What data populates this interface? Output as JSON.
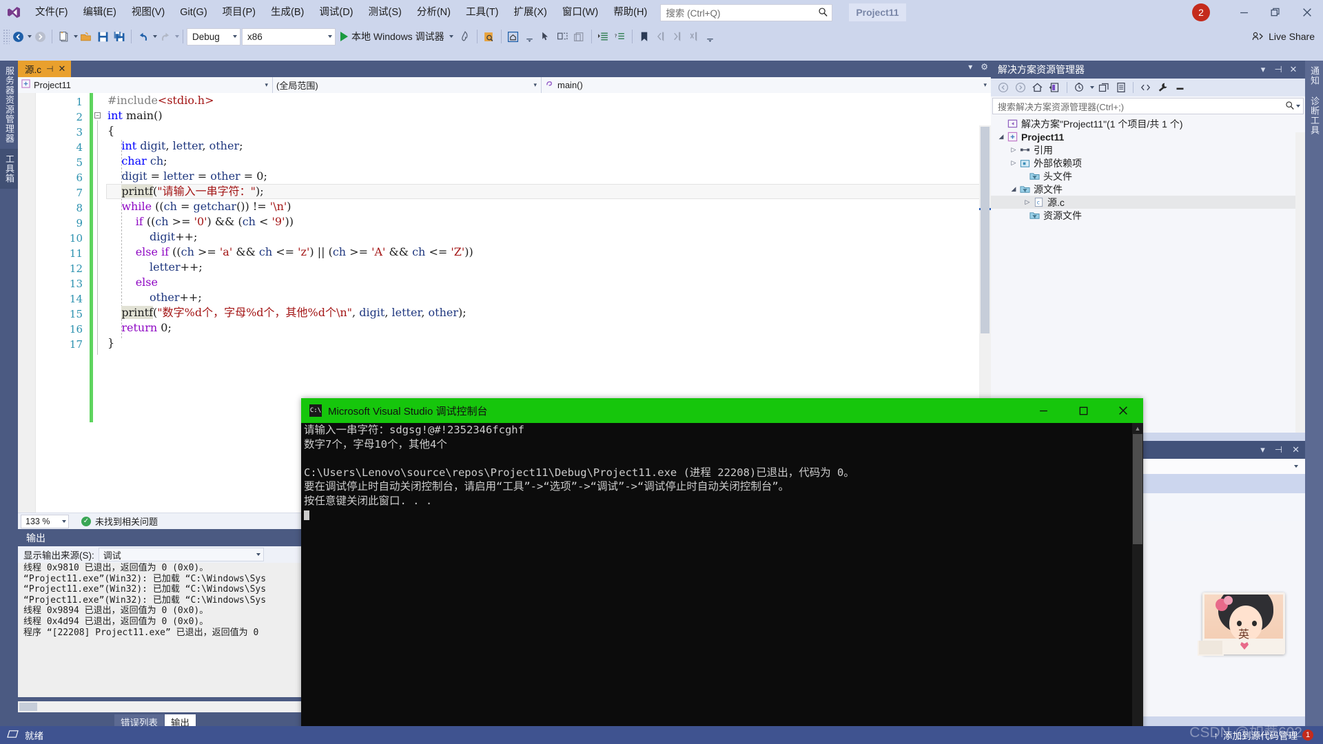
{
  "app": {
    "logo_icon": "visual-studio-icon",
    "project_chip": "Project11",
    "notification_count": "2"
  },
  "menu": {
    "items": [
      {
        "label": "文件(F)"
      },
      {
        "label": "编辑(E)"
      },
      {
        "label": "视图(V)"
      },
      {
        "label": "Git(G)"
      },
      {
        "label": "项目(P)"
      },
      {
        "label": "生成(B)"
      },
      {
        "label": "调试(D)"
      },
      {
        "label": "测试(S)"
      },
      {
        "label": "分析(N)"
      },
      {
        "label": "工具(T)"
      },
      {
        "label": "扩展(X)"
      },
      {
        "label": "窗口(W)"
      },
      {
        "label": "帮助(H)"
      }
    ]
  },
  "search": {
    "placeholder": "搜索 (Ctrl+Q)",
    "icon": "search-icon"
  },
  "window_controls": {
    "minimize": "minimize-icon",
    "restore": "restore-icon",
    "close": "close-icon"
  },
  "toolbar": {
    "config": "Debug",
    "platform": "x86",
    "run_label": "本地 Windows 调试器",
    "live_share": "Live Share"
  },
  "left_strip": {
    "tabs": [
      "服务器资源管理器",
      "工具箱"
    ]
  },
  "right_strip": {
    "tabs": [
      "通知",
      "诊断工具"
    ]
  },
  "editor": {
    "tab_label": "源.c",
    "nav": {
      "project": "Project11",
      "scope": "(全局范围)",
      "member": "main()"
    },
    "zoom": "133 %",
    "issue_status": "未找到相关问题",
    "lines": [
      {
        "n": "1",
        "text": "#include<stdio.h>"
      },
      {
        "n": "2",
        "text": "int main()"
      },
      {
        "n": "3",
        "text": "{"
      },
      {
        "n": "4",
        "text": "    int digit, letter, other;"
      },
      {
        "n": "5",
        "text": "    char ch;"
      },
      {
        "n": "6",
        "text": "    digit = letter = other = 0;"
      },
      {
        "n": "7",
        "text": "    printf(\"请输入一串字符：\");"
      },
      {
        "n": "8",
        "text": "    while ((ch = getchar()) != '\\n')"
      },
      {
        "n": "9",
        "text": "        if ((ch >= '0') && (ch < '9'))"
      },
      {
        "n": "10",
        "text": "            digit++;"
      },
      {
        "n": "11",
        "text": "        else if ((ch >= 'a' && ch <= 'z') || (ch >= 'A' && ch <= 'Z'))"
      },
      {
        "n": "12",
        "text": "            letter++;"
      },
      {
        "n": "13",
        "text": "        else"
      },
      {
        "n": "14",
        "text": "            other++;"
      },
      {
        "n": "15",
        "text": "    printf(\"数字%d个，字母%d个，其他%d个\\n\", digit, letter, other);"
      },
      {
        "n": "16",
        "text": "    return 0;"
      },
      {
        "n": "17",
        "text": "}"
      }
    ]
  },
  "output": {
    "title": "输出",
    "source_label": "显示输出来源(S):",
    "source_value": "调试",
    "lines": [
      "线程 0x9810 已退出，返回值为 0 (0x0)。",
      "“Project11.exe”(Win32): 已加载 “C:\\Windows\\Sys",
      "“Project11.exe”(Win32): 已加载 “C:\\Windows\\Sys",
      "“Project11.exe”(Win32): 已加载 “C:\\Windows\\Sys",
      "线程 0x9894 已退出，返回值为 0 (0x0)。",
      "线程 0x4d94 已退出，返回值为 0 (0x0)。",
      "程序 “[22208] Project11.exe” 已退出，返回值为 0"
    ],
    "tabs": [
      {
        "label": "错误列表",
        "active": false
      },
      {
        "label": "输出",
        "active": true
      }
    ]
  },
  "solution_explorer": {
    "title": "解决方案资源管理器",
    "search_placeholder": "搜索解决方案资源管理器(Ctrl+;)",
    "toolbar_icons": [
      "back-icon",
      "forward-icon",
      "home-icon",
      "sync-with-active-document-icon",
      "pending-changes-icon",
      "collapse-all-icon",
      "properties-icon",
      "show-all-files-icon",
      "wrench-icon",
      "minus-icon"
    ],
    "tree": [
      {
        "label": "解决方案\"Project11\"(1 个项目/共 1 个)",
        "indent": 0,
        "twisty": "",
        "icon": "solution-icon",
        "bold": false,
        "selected": false
      },
      {
        "label": "Project11",
        "indent": 1,
        "twisty": "▲",
        "icon": "project-icon",
        "bold": true,
        "selected": false
      },
      {
        "label": "引用",
        "indent": 2,
        "twisty": "▶",
        "icon": "references-icon",
        "bold": false,
        "selected": false
      },
      {
        "label": "外部依赖项",
        "indent": 2,
        "twisty": "▶",
        "icon": "external-deps-icon",
        "bold": false,
        "selected": false
      },
      {
        "label": "头文件",
        "indent": 3,
        "twisty": "",
        "icon": "filter-folder-icon",
        "bold": false,
        "selected": false
      },
      {
        "label": "源文件",
        "indent": 2,
        "twisty": "▲",
        "icon": "filter-folder-icon",
        "bold": false,
        "selected": false
      },
      {
        "label": "源.c",
        "indent": 3,
        "twisty": "▶",
        "icon": "c-file-icon",
        "bold": false,
        "selected": true
      },
      {
        "label": "资源文件",
        "indent": 3,
        "twisty": "",
        "icon": "filter-folder-icon",
        "bold": false,
        "selected": false
      }
    ]
  },
  "console": {
    "title": "Microsoft Visual Studio 调试控制台",
    "icon": "console-icon",
    "lines": [
      "请输入一串字符：sdgsg!@#!2352346fcghf",
      "数字7个，字母10个，其他4个",
      "",
      "C:\\Users\\Lenovo\\source\\repos\\Project11\\Debug\\Project11.exe (进程 22208)已退出，代码为 0。",
      "要在调试停止时自动关闭控制台，请启用“工具”->“选项”->“调试”->“调试停止时自动关闭控制台”。",
      "按任意键关闭此窗口. . ."
    ],
    "controls": {
      "minimize": "minimize-icon",
      "maximize": "maximize-icon",
      "close": "close-icon"
    }
  },
  "statusbar": {
    "ready": "就绪",
    "source_control": "添加到源代码管理",
    "error_count": "1",
    "watermark": "CSDN @如薏602"
  },
  "sticker": {
    "char": "英"
  },
  "colors": {
    "chrome": "#cdd6ec",
    "panel_header": "#4b5a82",
    "console_title": "#16c60c",
    "status_bar": "#3f5390",
    "accent_tab": "#e9a02d",
    "change_bar": "#5ed45e",
    "notification": "#c42b1c"
  }
}
